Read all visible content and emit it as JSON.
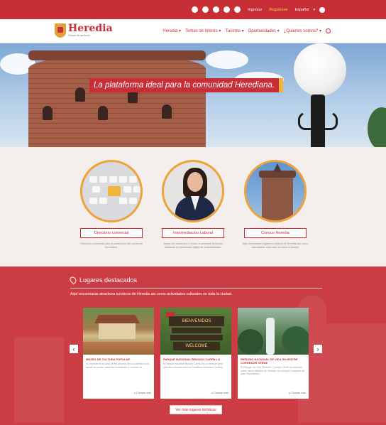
{
  "topbar": {
    "social": [
      "twitter-icon",
      "facebook-icon",
      "youtube-icon",
      "instagram-icon",
      "pinterest-icon"
    ],
    "login": "Ingresar",
    "register": "Registrese",
    "language": "Español",
    "language_caret": "▾",
    "accessibility_icon": "accessibility-icon"
  },
  "header": {
    "logo_name": "Heredia",
    "logo_sub": "Ciudad de las flores",
    "nav": [
      "Heredia ▾",
      "Temas de interés ▾",
      "Turismo ▾",
      "Oportunidades ▾",
      "¿Quienes somos? ▾"
    ],
    "search_icon": "search-icon"
  },
  "hero": {
    "banner": "La plataforma ideal para la comunidad Herediana."
  },
  "services": [
    {
      "button": "Directorio comercial",
      "desc": "Directorio comercial para la promoción del comercio herediano."
    },
    {
      "button": "Intermediación Laboral",
      "desc": "Jeque tus currículos e incluir el personal deseado mediante la plataforma digital de empleabilidad."
    },
    {
      "button": "Conoce Heredia",
      "desc": "Aquí encontrará lugares turísticos de Heredia así como actividades culturales en toda la ciudad."
    }
  ],
  "places": {
    "title": "Lugares destacados",
    "intro": "Aquí encontrarás atractivos turísticos de Heredia así como actividades culturales en toda la ciudad.",
    "cards": [
      {
        "title": "MUSEO DE CULTURA POPULAR",
        "text": "Su esencia es la casa de los abuelos de la sociedad rural, donde se puede sustentar la tradición y conocer su...",
        "more": "▸ Conocer más"
      },
      {
        "title": "PARQUE NACIONAL BRAULIO CARRILLO",
        "text": "El Parque Nacional Braulio Carrillo es un área de gran atractivo ubicado entre la Cordillera Volcánica Central...",
        "more": "▸ Conocer más"
      },
      {
        "title": "REFUGIO NACIONAL DE VIDA SILVESTRE CORREDOR VERDE",
        "text": "El Refugio de Vida Silvestre Corredor Verde se extiende sobre varios distritos de Heredia, se protegen bosques de gran importancia...",
        "more": "▸ Conocer más"
      }
    ],
    "welcome_sign_1": "BIENVENIDOS",
    "welcome_sign_2": "WELCOME",
    "prev": "‹",
    "next": "›",
    "all_button": "Ver más lugares turísticos"
  }
}
